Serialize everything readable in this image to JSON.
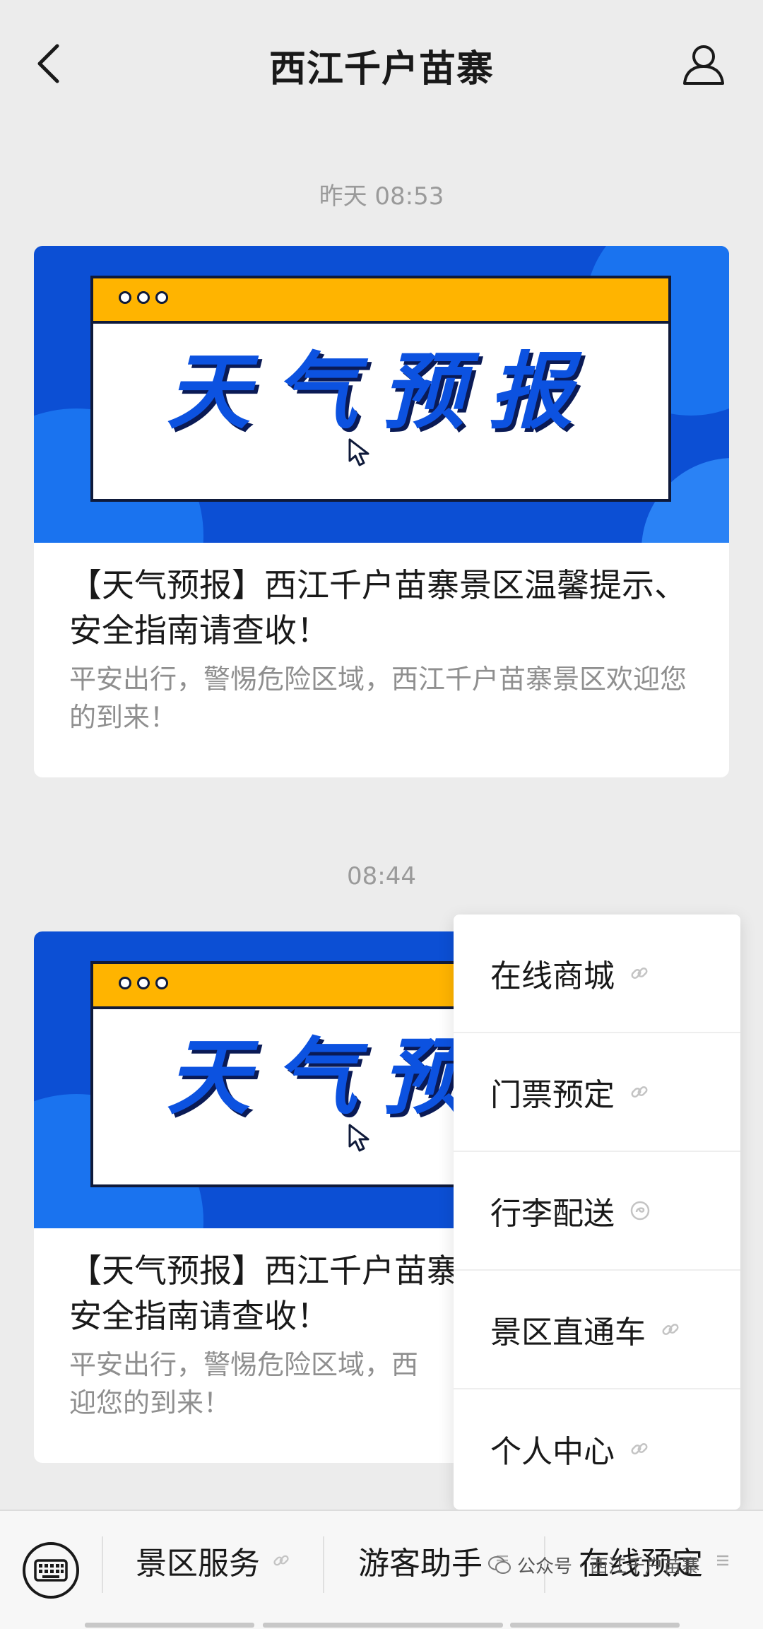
{
  "header": {
    "title": "西江千户苗寨"
  },
  "messages": [
    {
      "time": "昨天 08:53",
      "banner_text": "天气预报",
      "title": "【天气预报】西江千户苗寨景区温馨提示、安全指南请查收！",
      "desc": "平安出行，警惕危险区域，西江千户苗寨景区欢迎您的到来！"
    },
    {
      "time": "08:44",
      "banner_text": "天气预报",
      "title": "【天气预报】西江千户苗寨",
      "title_line2": "安全指南请查收！",
      "desc": "平安出行，警惕危险区域，西",
      "desc_line2": "迎您的到来！"
    }
  ],
  "popup_menu": {
    "items": [
      {
        "label": "在线商城",
        "icon": "link-icon"
      },
      {
        "label": "门票预定",
        "icon": "link-icon"
      },
      {
        "label": "行李配送",
        "icon": "miniprogram-icon"
      },
      {
        "label": "景区直通车",
        "icon": "link-icon"
      },
      {
        "label": "个人中心",
        "icon": "link-icon"
      }
    ]
  },
  "bottom_menu": {
    "tabs": [
      {
        "label": "景区服务",
        "icon": "link-icon"
      },
      {
        "label": "游客助手",
        "icon": "menu-lines-icon"
      },
      {
        "label": "在线预定",
        "icon": "menu-lines-icon"
      }
    ]
  },
  "watermark": {
    "text": "公众号 · 西江千户苗寨"
  },
  "colors": {
    "banner_blue": "#0c4fd4",
    "banner_yellow": "#ffb400",
    "background": "#ececec"
  }
}
